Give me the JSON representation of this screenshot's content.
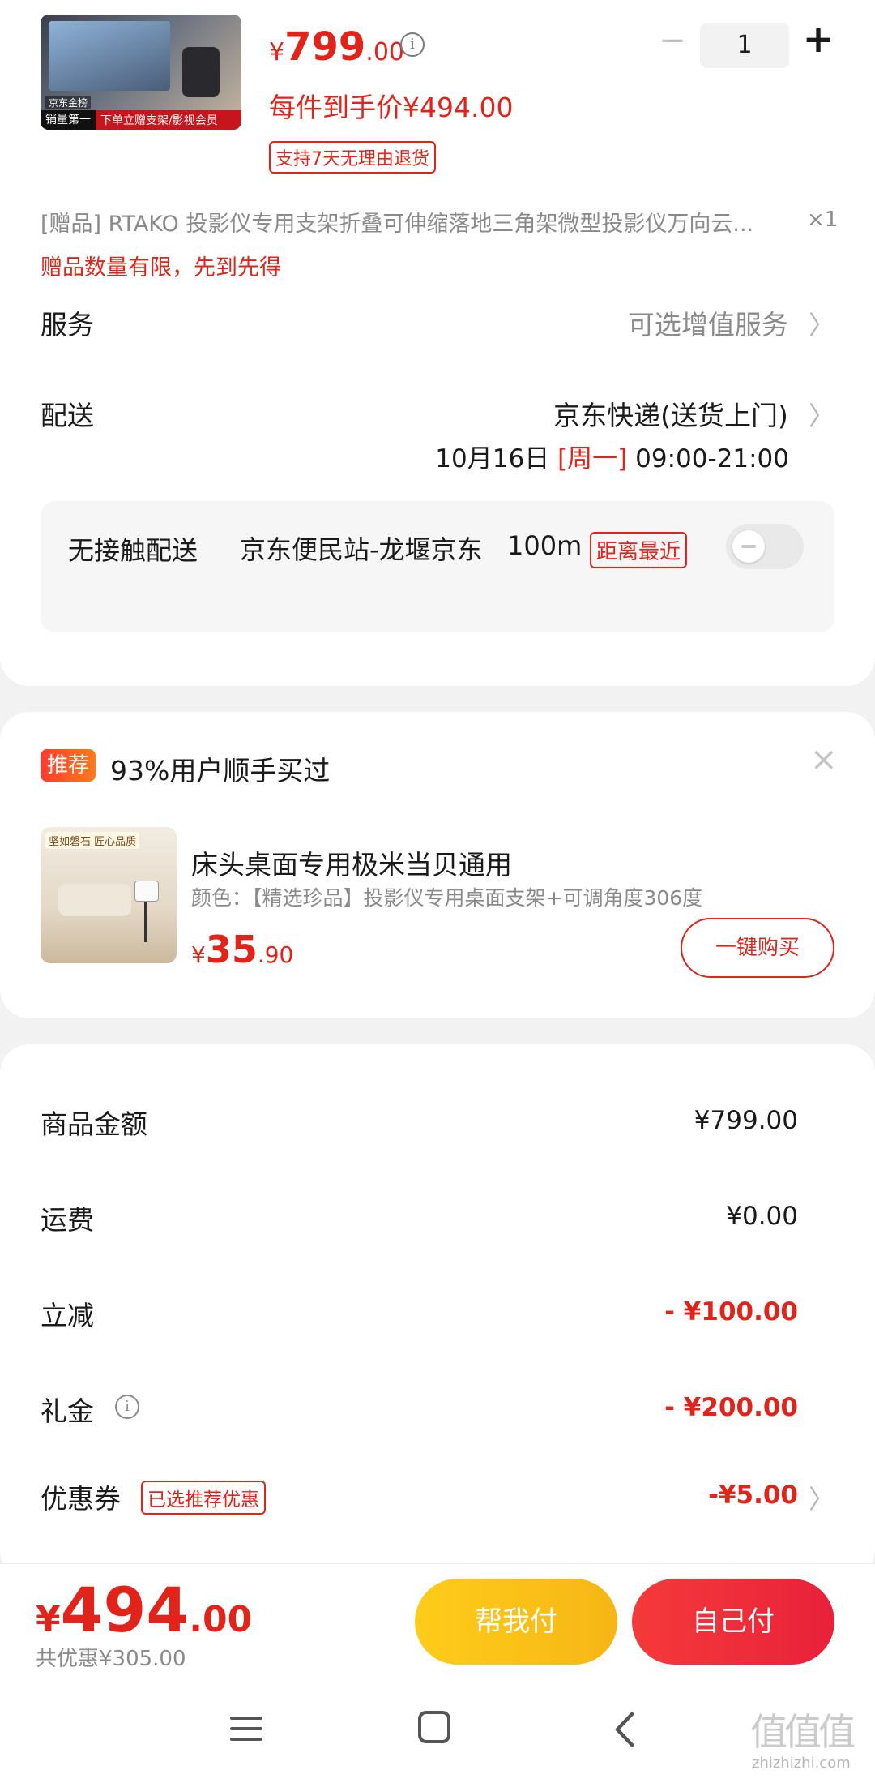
{
  "product": {
    "image_badge_left": "销量第一",
    "image_badge_right": "下单立赠支架/影视会员",
    "image_brand": "京东金榜",
    "price_symbol": "¥",
    "price_int": "799",
    "price_dec": ".00",
    "final_price_text": "每件到手价¥494.00",
    "return_tag": "支持7天无理由退货",
    "quantity": "1",
    "minus": "−",
    "plus": "+"
  },
  "gift": {
    "text": "[赠品]  RTAKO 投影仪专用支架折叠可伸缩落地三角架微型投影仪万向云...",
    "count": "×1",
    "notice": "赠品数量有限，先到先得"
  },
  "service": {
    "label": "服务",
    "value": "可选增值服务"
  },
  "delivery": {
    "label": "配送",
    "method": "京东快递(送货上门)",
    "date": "10月16日",
    "weekday": "[周一]",
    "time": "09:00-21:00"
  },
  "contactless": {
    "label": "无接触配送",
    "station": "京东便民站-龙堰京东",
    "distance": "100m",
    "tag": "距离最近"
  },
  "recommend": {
    "tag": "推荐",
    "title": "93%用户顺手买过",
    "close": "×",
    "image_text": "坚如磐石 匠心品质",
    "item_name": "床头桌面专用极米当贝通用",
    "item_spec": "颜色：【精选珍品】投影仪专用桌面支架+可调角度306度",
    "price_symbol": "¥",
    "price_int": "35",
    "price_dec": ".90",
    "buy_button": "一键购买"
  },
  "summary": [
    {
      "label": "商品金额",
      "value": "¥799.00",
      "red": false
    },
    {
      "label": "运费",
      "value": "¥0.00",
      "red": false
    },
    {
      "label": "立减",
      "value": "- ¥100.00",
      "red": true
    },
    {
      "label": "礼金",
      "value": "- ¥200.00",
      "red": true
    },
    {
      "label": "优惠券",
      "tag": "已选推荐优惠",
      "value": "-¥5.00",
      "red": true
    }
  ],
  "bottom": {
    "price_symbol": "¥",
    "price_int": "494",
    "price_dec": ".00",
    "saving": "共优惠¥305.00",
    "help_pay": "帮我付",
    "self_pay": "自己付"
  },
  "watermark": {
    "glyphs": "值值值",
    "site": "zhizhizhi.com"
  },
  "colors": {
    "accent": "#e2231a",
    "help_pay": "#f8c11c",
    "self_pay": "#ef2a3c"
  }
}
